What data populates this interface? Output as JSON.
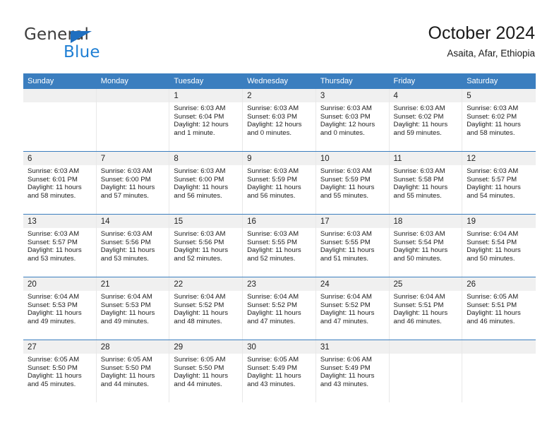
{
  "brand": {
    "name_part1": "General",
    "name_part2": "Blue",
    "triangle_color": "#1f6fc0",
    "blue_text_color": "#1f7fd4"
  },
  "header": {
    "title": "October 2024",
    "subtitle": "Asaita, Afar, Ethiopia",
    "accent_color": "#3b7ebf",
    "daynum_band_color": "#f0f0f0"
  },
  "weekdays": [
    "Sunday",
    "Monday",
    "Tuesday",
    "Wednesday",
    "Thursday",
    "Friday",
    "Saturday"
  ],
  "labels": {
    "sunrise": "Sunrise:",
    "sunset": "Sunset:",
    "daylight": "Daylight:"
  },
  "weeks": [
    [
      {
        "day": "",
        "empty": true
      },
      {
        "day": "",
        "empty": true
      },
      {
        "day": "1",
        "sunrise": "Sunrise: 6:03 AM",
        "sunset": "Sunset: 6:04 PM",
        "daylight": "Daylight: 12 hours and 1 minute."
      },
      {
        "day": "2",
        "sunrise": "Sunrise: 6:03 AM",
        "sunset": "Sunset: 6:03 PM",
        "daylight": "Daylight: 12 hours and 0 minutes."
      },
      {
        "day": "3",
        "sunrise": "Sunrise: 6:03 AM",
        "sunset": "Sunset: 6:03 PM",
        "daylight": "Daylight: 12 hours and 0 minutes."
      },
      {
        "day": "4",
        "sunrise": "Sunrise: 6:03 AM",
        "sunset": "Sunset: 6:02 PM",
        "daylight": "Daylight: 11 hours and 59 minutes."
      },
      {
        "day": "5",
        "sunrise": "Sunrise: 6:03 AM",
        "sunset": "Sunset: 6:02 PM",
        "daylight": "Daylight: 11 hours and 58 minutes."
      }
    ],
    [
      {
        "day": "6",
        "sunrise": "Sunrise: 6:03 AM",
        "sunset": "Sunset: 6:01 PM",
        "daylight": "Daylight: 11 hours and 58 minutes."
      },
      {
        "day": "7",
        "sunrise": "Sunrise: 6:03 AM",
        "sunset": "Sunset: 6:00 PM",
        "daylight": "Daylight: 11 hours and 57 minutes."
      },
      {
        "day": "8",
        "sunrise": "Sunrise: 6:03 AM",
        "sunset": "Sunset: 6:00 PM",
        "daylight": "Daylight: 11 hours and 56 minutes."
      },
      {
        "day": "9",
        "sunrise": "Sunrise: 6:03 AM",
        "sunset": "Sunset: 5:59 PM",
        "daylight": "Daylight: 11 hours and 56 minutes."
      },
      {
        "day": "10",
        "sunrise": "Sunrise: 6:03 AM",
        "sunset": "Sunset: 5:59 PM",
        "daylight": "Daylight: 11 hours and 55 minutes."
      },
      {
        "day": "11",
        "sunrise": "Sunrise: 6:03 AM",
        "sunset": "Sunset: 5:58 PM",
        "daylight": "Daylight: 11 hours and 55 minutes."
      },
      {
        "day": "12",
        "sunrise": "Sunrise: 6:03 AM",
        "sunset": "Sunset: 5:57 PM",
        "daylight": "Daylight: 11 hours and 54 minutes."
      }
    ],
    [
      {
        "day": "13",
        "sunrise": "Sunrise: 6:03 AM",
        "sunset": "Sunset: 5:57 PM",
        "daylight": "Daylight: 11 hours and 53 minutes."
      },
      {
        "day": "14",
        "sunrise": "Sunrise: 6:03 AM",
        "sunset": "Sunset: 5:56 PM",
        "daylight": "Daylight: 11 hours and 53 minutes."
      },
      {
        "day": "15",
        "sunrise": "Sunrise: 6:03 AM",
        "sunset": "Sunset: 5:56 PM",
        "daylight": "Daylight: 11 hours and 52 minutes."
      },
      {
        "day": "16",
        "sunrise": "Sunrise: 6:03 AM",
        "sunset": "Sunset: 5:55 PM",
        "daylight": "Daylight: 11 hours and 52 minutes."
      },
      {
        "day": "17",
        "sunrise": "Sunrise: 6:03 AM",
        "sunset": "Sunset: 5:55 PM",
        "daylight": "Daylight: 11 hours and 51 minutes."
      },
      {
        "day": "18",
        "sunrise": "Sunrise: 6:03 AM",
        "sunset": "Sunset: 5:54 PM",
        "daylight": "Daylight: 11 hours and 50 minutes."
      },
      {
        "day": "19",
        "sunrise": "Sunrise: 6:04 AM",
        "sunset": "Sunset: 5:54 PM",
        "daylight": "Daylight: 11 hours and 50 minutes."
      }
    ],
    [
      {
        "day": "20",
        "sunrise": "Sunrise: 6:04 AM",
        "sunset": "Sunset: 5:53 PM",
        "daylight": "Daylight: 11 hours and 49 minutes."
      },
      {
        "day": "21",
        "sunrise": "Sunrise: 6:04 AM",
        "sunset": "Sunset: 5:53 PM",
        "daylight": "Daylight: 11 hours and 49 minutes."
      },
      {
        "day": "22",
        "sunrise": "Sunrise: 6:04 AM",
        "sunset": "Sunset: 5:52 PM",
        "daylight": "Daylight: 11 hours and 48 minutes."
      },
      {
        "day": "23",
        "sunrise": "Sunrise: 6:04 AM",
        "sunset": "Sunset: 5:52 PM",
        "daylight": "Daylight: 11 hours and 47 minutes."
      },
      {
        "day": "24",
        "sunrise": "Sunrise: 6:04 AM",
        "sunset": "Sunset: 5:52 PM",
        "daylight": "Daylight: 11 hours and 47 minutes."
      },
      {
        "day": "25",
        "sunrise": "Sunrise: 6:04 AM",
        "sunset": "Sunset: 5:51 PM",
        "daylight": "Daylight: 11 hours and 46 minutes."
      },
      {
        "day": "26",
        "sunrise": "Sunrise: 6:05 AM",
        "sunset": "Sunset: 5:51 PM",
        "daylight": "Daylight: 11 hours and 46 minutes."
      }
    ],
    [
      {
        "day": "27",
        "sunrise": "Sunrise: 6:05 AM",
        "sunset": "Sunset: 5:50 PM",
        "daylight": "Daylight: 11 hours and 45 minutes."
      },
      {
        "day": "28",
        "sunrise": "Sunrise: 6:05 AM",
        "sunset": "Sunset: 5:50 PM",
        "daylight": "Daylight: 11 hours and 44 minutes."
      },
      {
        "day": "29",
        "sunrise": "Sunrise: 6:05 AM",
        "sunset": "Sunset: 5:50 PM",
        "daylight": "Daylight: 11 hours and 44 minutes."
      },
      {
        "day": "30",
        "sunrise": "Sunrise: 6:05 AM",
        "sunset": "Sunset: 5:49 PM",
        "daylight": "Daylight: 11 hours and 43 minutes."
      },
      {
        "day": "31",
        "sunrise": "Sunrise: 6:06 AM",
        "sunset": "Sunset: 5:49 PM",
        "daylight": "Daylight: 11 hours and 43 minutes."
      },
      {
        "day": "",
        "empty": true
      },
      {
        "day": "",
        "empty": true
      }
    ]
  ]
}
